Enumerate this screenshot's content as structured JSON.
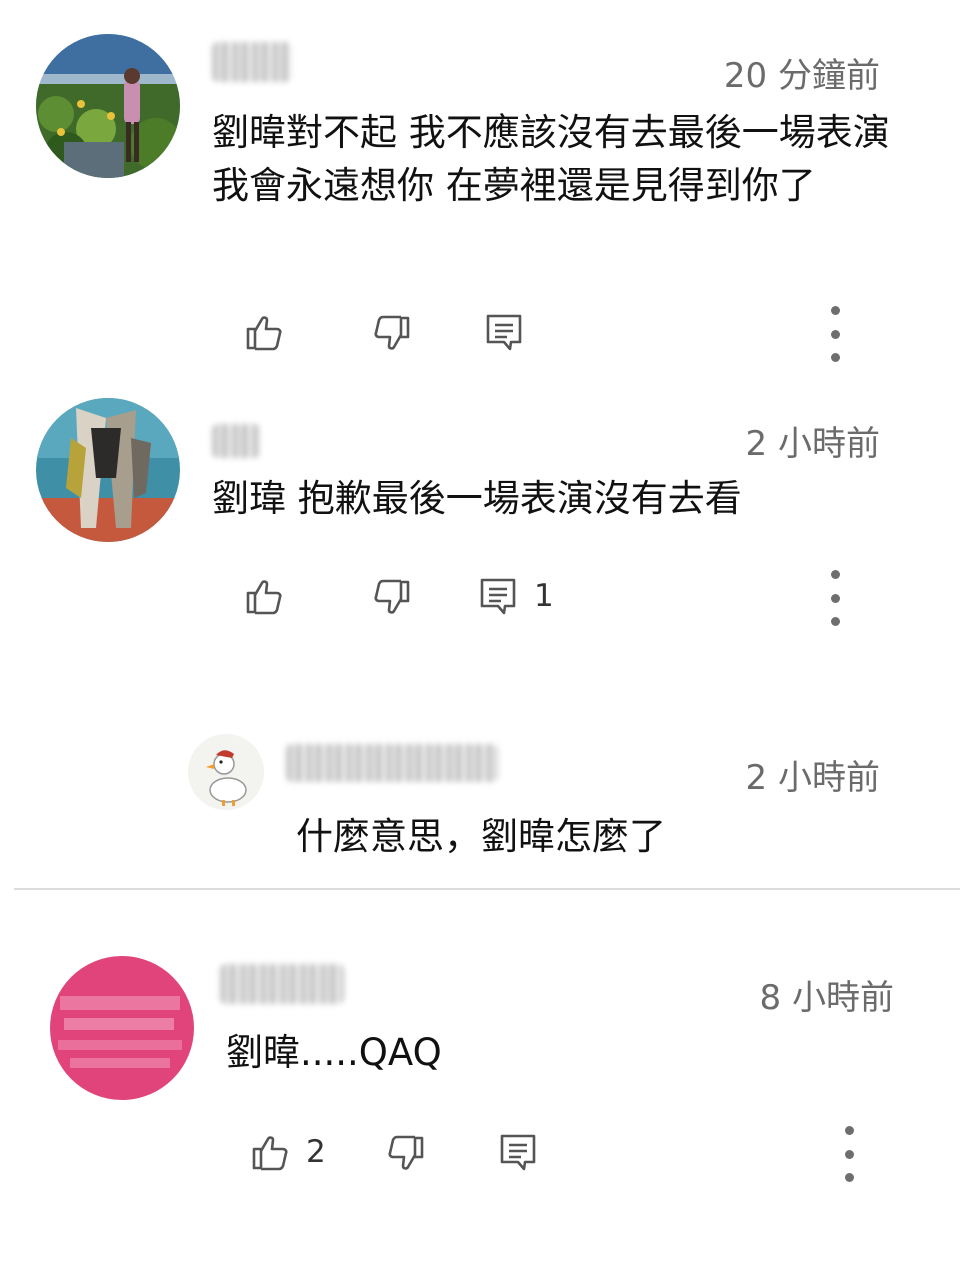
{
  "comments": [
    {
      "time": "20 分鐘前",
      "text": "劉暐對不起 我不應該沒有去最後一場表演 我會永遠想你 在夢裡還是見得到你了",
      "like_count": "",
      "reply_count": ""
    },
    {
      "time": "2 小時前",
      "text": "劉瑋 抱歉最後一場表演沒有去看",
      "like_count": "",
      "reply_count": "1"
    },
    {
      "time": "2 小時前",
      "text": "什麼意思，劉暐怎麼了",
      "is_reply": true
    },
    {
      "time": "8 小時前",
      "text": "劉暐.....QAQ",
      "like_count": "2",
      "reply_count": ""
    }
  ],
  "icons": {
    "like": "thumbs-up-icon",
    "dislike": "thumbs-down-icon",
    "reply": "comment-reply-icon",
    "more": "more-vertical-icon"
  },
  "colors": {
    "time_text": "#6b6b6b",
    "icon": "#555555",
    "avatar_4": "#e0447b"
  }
}
